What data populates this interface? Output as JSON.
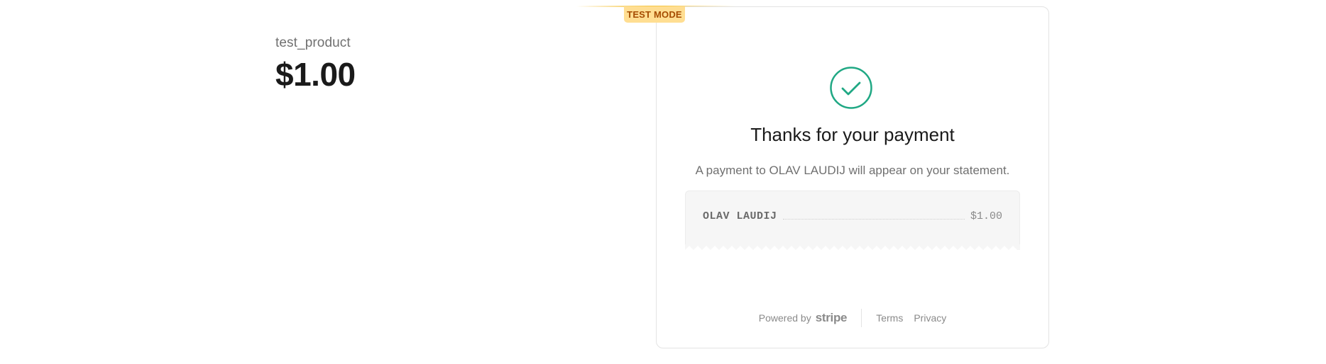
{
  "product": {
    "name": "test_product",
    "price": "$1.00"
  },
  "test_mode": {
    "label": "TEST MODE",
    "color": "#ffde92",
    "text_color": "#a54c00"
  },
  "confirmation": {
    "icon": "check-circle-icon",
    "icon_color": "#20a884",
    "title": "Thanks for your payment",
    "statement": "A payment to OLAV LAUDIJ will appear on your statement."
  },
  "receipt": {
    "merchant": "OLAV LAUDIJ",
    "amount": "$1.00"
  },
  "footer": {
    "powered_by": "Powered by",
    "brand": "stripe",
    "links": {
      "terms": "Terms",
      "privacy": "Privacy"
    }
  }
}
